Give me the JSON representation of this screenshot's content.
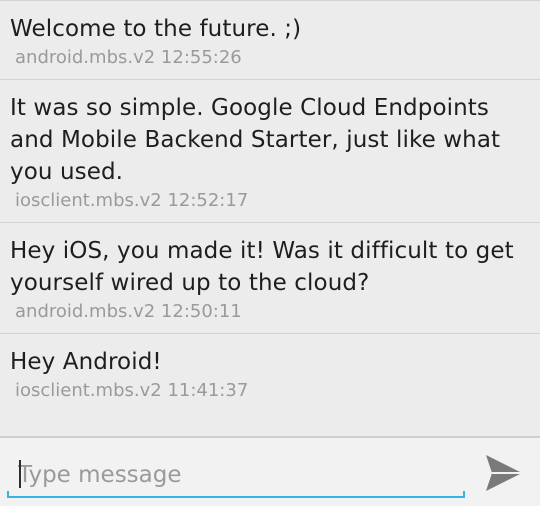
{
  "messages": [
    {
      "text": "Welcome to the future. ;)",
      "meta": "android.mbs.v2 12:55:26"
    },
    {
      "text": "It was so simple. Google Cloud Endpoints and Mobile Backend Starter, just like what you used.",
      "meta": "iosclient.mbs.v2 12:52:17"
    },
    {
      "text": "Hey iOS, you made it! Was it difficult to get yourself wired up to the cloud?",
      "meta": "android.mbs.v2 12:50:11"
    },
    {
      "text": "Hey Android!",
      "meta": "iosclient.mbs.v2 11:41:37"
    }
  ],
  "composer": {
    "placeholder": "Type message",
    "value": "",
    "send_icon": "send-icon"
  },
  "colors": {
    "background": "#ececec",
    "text": "#1e1e1e",
    "meta": "#9a9a9a",
    "accent": "#33b5e5",
    "send_icon": "#7a7a7a"
  }
}
